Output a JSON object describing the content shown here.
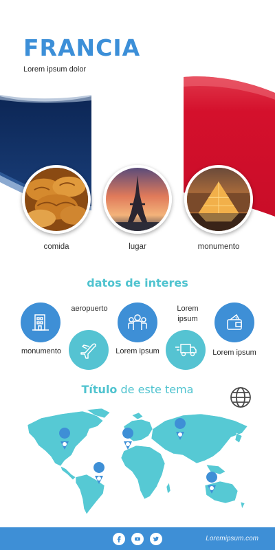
{
  "header": {
    "title": "FRANCIA",
    "subtitle": "Lorem ipsum dolor"
  },
  "colors": {
    "flag_blue": "#0f2a5a",
    "flag_red": "#d6102f",
    "accent_blue": "#3e8fd6",
    "accent_teal": "#55c3d2",
    "map_teal": "#56c9d4"
  },
  "photos": [
    {
      "label": "comida",
      "icon": "croissant-photo"
    },
    {
      "label": "lugar",
      "icon": "eiffel-tower-photo"
    },
    {
      "label": "monumento",
      "icon": "louvre-pyramid-photo"
    }
  ],
  "datos": {
    "title": "datos de interes",
    "items": [
      {
        "label": "monumento",
        "icon": "building-icon"
      },
      {
        "label": "aeropuerto",
        "icon": "airplane-icon"
      },
      {
        "label": "Lorem ipsum",
        "icon": "people-icon"
      },
      {
        "label": "Lorem ipsum",
        "icon": "truck-icon"
      },
      {
        "label": "Lorem ipsum",
        "icon": "wallet-icon"
      }
    ],
    "lorem_top": "Lorem\nipsum"
  },
  "tema": {
    "title_bold": "Título",
    "title_rest": " de este tema",
    "icon": "globe-icon"
  },
  "footer": {
    "url": "Loremipsum.com",
    "social": [
      "facebook-icon",
      "youtube-icon",
      "twitter-icon"
    ]
  }
}
